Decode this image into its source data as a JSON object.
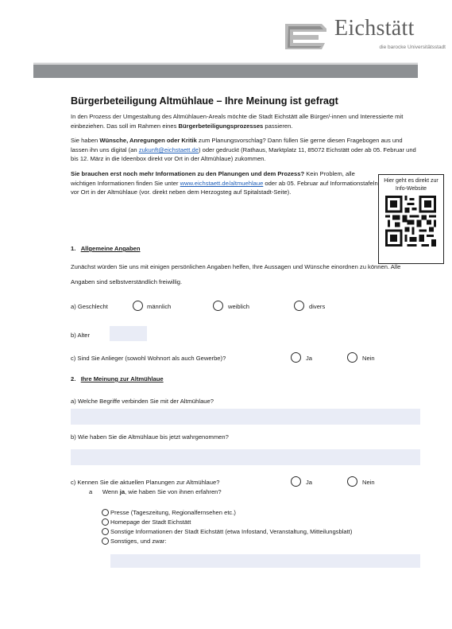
{
  "logo": {
    "name": "Eichstätt",
    "subtitle": "die barocke Universitätsstadt"
  },
  "title": "Bürgerbeteiligung Altmühlaue – Ihre Meinung ist gefragt",
  "intro": {
    "p1_a": "In den Prozess der Umgestaltung des Altmühlauen-Areals möchte die Stadt Eichstätt alle Bürger/-innen und Interessierte mit einbeziehen. Das soll im Rahmen eines ",
    "p1_b": "Bürgerbeteiligungsprozesses",
    "p1_c": " passieren.",
    "p2_a": "Sie haben ",
    "p2_b": "Wünsche, Anregungen oder Kritik",
    "p2_c": " zum Planungsvorschlag? Dann füllen Sie gerne diesen Fragebogen aus und lassen ihn uns digital (an ",
    "p2_email": "zukunft@eichstaett.de",
    "p2_d": ") oder gedruckt (Rathaus, Marktplatz 11, 85072 Eichstätt oder ab 05. Februar und bis 12. März in die Ideenbox direkt vor Ort in der Altmühlaue) zukommen.",
    "p3_a": "Sie brauchen erst noch mehr Informationen zu den Planungen und dem Prozess?",
    "p3_b": " Kein Problem, alle wichtigen Informationen finden Sie unter ",
    "p3_link": "www.eichstaett.de/altmuehlaue",
    "p3_c": " oder ab 05. Februar auf Informationstafeln vor Ort in der Altmühlaue (vor. direkt neben dem Herzogsteg auf Spitalstadt-Seite)."
  },
  "qr": {
    "caption": "Hier geht es direkt zur Info-Website"
  },
  "section1": {
    "number": "1.",
    "title": "Allgemeine Angaben",
    "text": "Zunächst würden Sie uns mit einigen persönlichen Angaben helfen, Ihre Aussagen und Wünsche einordnen zu können. Alle Angaben sind selbstverständlich freiwillig.",
    "gender_label": "a) Geschlecht",
    "gender_options": [
      "männlich",
      "weiblich",
      "divers"
    ],
    "age_label": "b)  Alter",
    "resident_label": "c)  Sind Sie Anlieger (sowohl Wohnort als auch Gewerbe)?",
    "yes": "Ja",
    "no": "Nein"
  },
  "section2": {
    "number": "2.",
    "title": "Ihre Meinung zur Altmühlaue",
    "qa": "a)  Welche Begriffe verbinden Sie mit der Altmühlaue?",
    "qb": "b)  Wie haben Sie die Altmühlaue bis jetzt wahrgenommen?",
    "qc": "c)  Kennen Sie die aktuellen Planungen zur Altmühlaue?",
    "yes": "Ja",
    "no": "Nein",
    "sub_a_prefix": "a      Wenn ",
    "sub_a_bold": "ja",
    "sub_a_suffix": ", wie haben Sie von ihnen erfahren?",
    "sources": [
      "Presse (Tageszeitung, Regionalfernsehen etc.)",
      "Homepage der Stadt Eichstätt",
      "Sonstige Informationen der Stadt Eichstätt (etwa Infostand, Veranstaltung, Mitteilungsblatt)",
      "Sonstiges, und zwar:"
    ]
  }
}
